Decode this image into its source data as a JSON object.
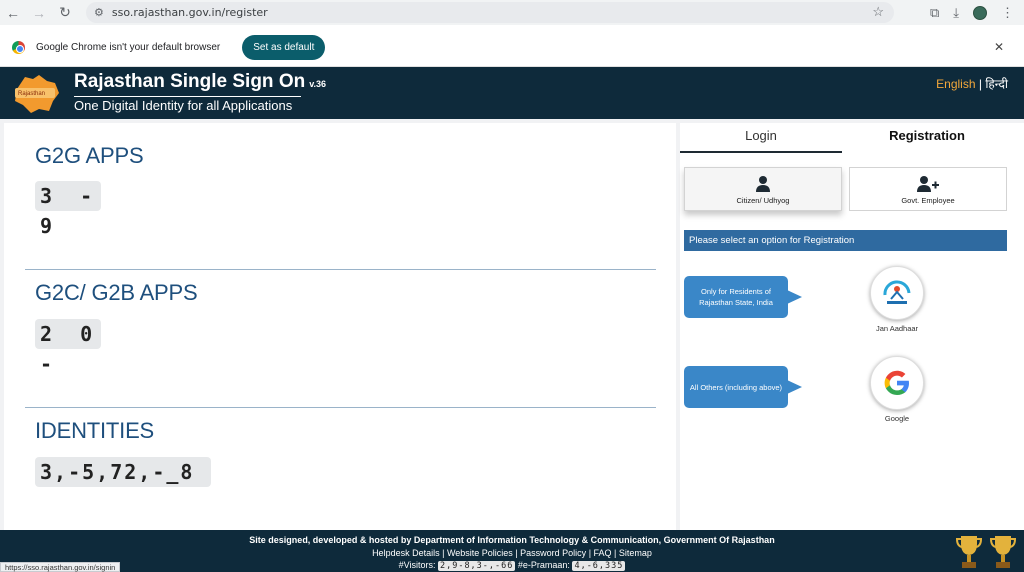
{
  "browser": {
    "url": "sso.rajasthan.gov.in/register",
    "info_text": "Google Chrome isn't your default browser",
    "set_default_label": "Set as default"
  },
  "header": {
    "title": "Rajasthan Single Sign On",
    "version": "v.36",
    "subtitle": "One Digital Identity for all Applications",
    "lang_english": "English",
    "lang_separator": "|",
    "lang_hindi": "हिन्दी"
  },
  "stats": [
    {
      "title": "G2G APPS",
      "value": "3 - 9"
    },
    {
      "title": "G2C/ G2B APPS",
      "value": "2 0 -"
    },
    {
      "title": "IDENTITIES",
      "value": "3,-5,72,-_8"
    }
  ],
  "tabs": {
    "login": "Login",
    "registration": "Registration"
  },
  "registration": {
    "citizen_label": "Citizen/ Udhyog",
    "govt_label": "Govt. Employee",
    "banner": "Please select an option for Registration",
    "residents_bubble": "Only for Residents of Rajasthan State, India",
    "others_bubble": "All Others (including above)",
    "jan_aadhaar_label": "Jan Aadhaar",
    "google_label": "Google"
  },
  "footer": {
    "line1": "Site designed, developed & hosted by Department of Information Technology & Communication, Government Of Rajasthan",
    "links": [
      "Helpdesk Details",
      "Website Policies",
      "Password Policy",
      "FAQ",
      "Sitemap"
    ],
    "visitors_label": "#Visitors:",
    "visitors_value": "2,9-8,3-,-66",
    "epramaan_label": "#e-Pramaan:",
    "epramaan_value": "4,-6,335"
  },
  "status_url": "https://sso.rajasthan.gov.in/signin",
  "colors": {
    "header_bg": "#0e2a3b",
    "stat_title": "#1e4f7d",
    "banner": "#2f6aa0",
    "bubble": "#3a87c8",
    "lang_accent": "#f2a73b",
    "set_default_bg": "#0b5d6b"
  }
}
